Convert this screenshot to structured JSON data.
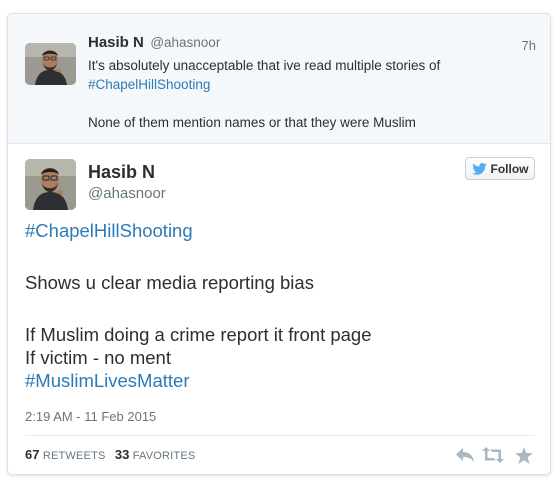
{
  "parent_tweet": {
    "fullname": "Hasib N",
    "handle": "@ahasnoor",
    "time": "7h",
    "text_lines": [
      "It's absolutely unacceptable that ive read multiple stories of",
      "#ChapelHillShooting",
      "",
      "None of them mention names or that they were Muslim"
    ]
  },
  "main_tweet": {
    "fullname": "Hasib N",
    "handle": "@ahasnoor",
    "follow_label": "Follow",
    "text_lines": [
      "#ChapelHillShooting",
      "",
      "Shows u clear media reporting bias",
      "",
      "If Muslim doing a crime report it front page",
      "If victim - no ment",
      "#MuslimLivesMatter"
    ],
    "timestamp": "2:19 AM - 11 Feb 2015",
    "retweets_count": "67",
    "retweets_label": "RETWEETS",
    "favorites_count": "33",
    "favorites_label": "FAVORITES"
  },
  "icons": {
    "follow": "twitter-bird-icon",
    "reply": "reply-icon",
    "retweet": "retweet-icon",
    "favorite": "star-icon"
  },
  "colors": {
    "hashtag": "#2b7bb9",
    "parent_background": "#f5f8fa",
    "twitter_blue": "#55acee",
    "muted_text": "#66757f",
    "action_icon": "#aab8c2"
  }
}
